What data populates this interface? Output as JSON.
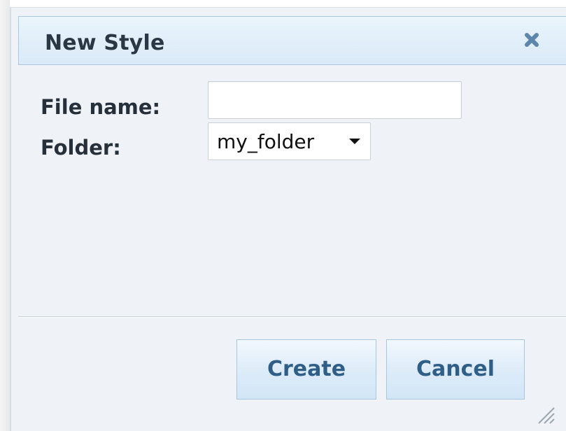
{
  "dialog": {
    "title": "New Style",
    "close_icon": "close-icon",
    "fields": {
      "file_name_label": "File name:",
      "file_name_value": "",
      "folder_label": "Folder:",
      "folder_value": "my_folder"
    },
    "buttons": {
      "create_label": "Create",
      "cancel_label": "Cancel"
    },
    "resize_icon": "resize-grip-icon"
  },
  "colors": {
    "titlebar": "#d9eaf7",
    "dialog_background": "#eff3f7",
    "button_text": "#2f5f86",
    "label_text": "#26303a"
  }
}
